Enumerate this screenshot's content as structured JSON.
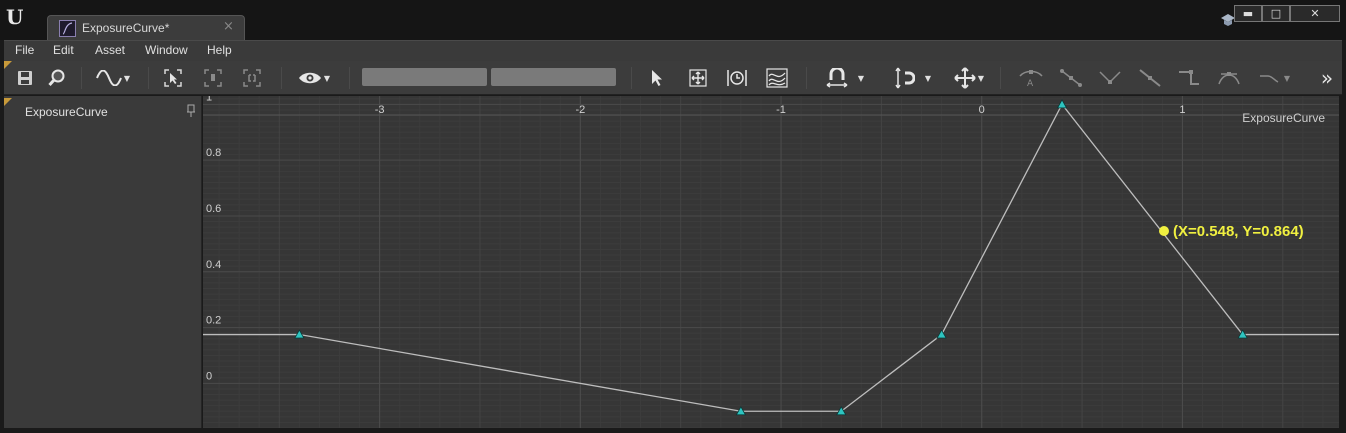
{
  "window": {
    "tab_title": "ExposureCurve*",
    "tab_close": "×",
    "controls": {
      "minimize": "▬",
      "maximize": "□",
      "close": "✕"
    }
  },
  "menu": [
    "File",
    "Edit",
    "Asset",
    "Window",
    "Help"
  ],
  "toolbar": {
    "icons": [
      "save-icon",
      "browse-icon",
      "curve-display-icon",
      "frame-selection-icon",
      "frame-key-icon",
      "frame-all-icon",
      "visibility-icon",
      "select-icon",
      "transform-icon",
      "retime-icon",
      "multi-scale-icon",
      "snap-time-icon",
      "snap-value-icon",
      "move-axis-icon",
      "tangent-auto-icon",
      "tangent-user-icon",
      "tangent-break-icon",
      "tangent-linear-icon",
      "tangent-constant-icon",
      "flatten-icon",
      "straighten-icon",
      "overflow-icon"
    ],
    "more": "»"
  },
  "curves_panel": {
    "curve_name": "ExposureCurve"
  },
  "graph": {
    "title": "ExposureCurve",
    "readout": "(X=0.548, Y=0.864)"
  },
  "chart_data": {
    "type": "line",
    "title": "ExposureCurve",
    "x_ticks": [
      "-3",
      "-2",
      "-1",
      "0",
      "1"
    ],
    "y_ticks": [
      "1",
      "0.8",
      "0.6",
      "0.4",
      "0.2",
      "0"
    ],
    "xlim": [
      -3.88,
      1.78
    ],
    "ylim": [
      -0.16,
      1.03
    ],
    "series": [
      {
        "name": "ExposureCurve",
        "line_color": "#bdbdbd",
        "key_color": "#2ec4c0",
        "points": [
          {
            "x": -3.4,
            "y": 0.175
          },
          {
            "x": -1.2,
            "y": -0.1
          },
          {
            "x": -0.7,
            "y": -0.1
          },
          {
            "x": -0.2,
            "y": 0.175
          },
          {
            "x": 0.4,
            "y": 1.0
          },
          {
            "x": 1.3,
            "y": 0.175
          }
        ],
        "extend_before": 0.175,
        "extend_after": 0.175
      }
    ],
    "cursor": {
      "x": 0.88,
      "y": 0.56
    },
    "grid": true
  }
}
